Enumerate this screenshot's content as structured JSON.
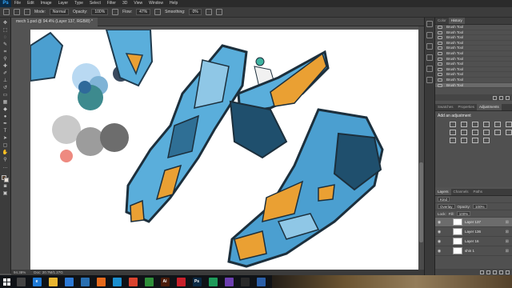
{
  "menu": {
    "logo": "Ps",
    "items": [
      "File",
      "Edit",
      "Image",
      "Layer",
      "Type",
      "Select",
      "Filter",
      "3D",
      "View",
      "Window",
      "Help"
    ]
  },
  "options": {
    "mode_label": "Mode:",
    "mode_value": "Normal",
    "opacity_label": "Opacity:",
    "opacity_value": "100%",
    "flow_label": "Flow:",
    "flow_value": "47%",
    "smoothing_label": "Smoothing:",
    "smoothing_value": "0%"
  },
  "document": {
    "tab_title": "mech 1.psd @ 94.4% (Layer 137, RGB/8) *",
    "zoom": "94.38%",
    "doc_info": "Doc: 20.7M/1.27G"
  },
  "history": {
    "tabs": [
      "Color",
      "History"
    ],
    "active_tab": "History",
    "rows": [
      "Brush Tool",
      "Brush Tool",
      "Brush Tool",
      "Brush Tool",
      "Brush Tool",
      "Brush Tool",
      "Brush Tool",
      "Brush Tool",
      "Brush Tool",
      "Brush Tool",
      "Brush Tool",
      "Brush Tool"
    ],
    "selected_index": 11
  },
  "adjustments": {
    "tabs": [
      "Swatches",
      "Properties",
      "Adjustments"
    ],
    "active_tab": "Adjustments",
    "label": "Add an adjustment"
  },
  "layers": {
    "tabs": [
      "Layers",
      "Channels",
      "Paths"
    ],
    "active_tab": "Layers",
    "kind_label": "Kind",
    "blend_mode": "Overlay",
    "opacity_label": "Opacity:",
    "opacity_value": "100%",
    "lock_label": "Lock:",
    "fill_label": "Fill:",
    "fill_value": "100%",
    "rows": [
      {
        "name": "Layer 137",
        "selected": true
      },
      {
        "name": "Layer 136",
        "selected": false
      },
      {
        "name": "Layer 16",
        "selected": false
      },
      {
        "name": "shin 1",
        "selected": false
      }
    ]
  },
  "taskbar": {
    "apps": [
      {
        "name": "task-view",
        "color": "#444444",
        "text": ""
      },
      {
        "name": "edge",
        "color": "#1f7ad6",
        "text": "e"
      },
      {
        "name": "file-explorer",
        "color": "#e8b531",
        "text": ""
      },
      {
        "name": "store",
        "color": "#2d7ad6",
        "text": ""
      },
      {
        "name": "app-box",
        "color": "#2a6fb0",
        "text": ""
      },
      {
        "name": "firefox",
        "color": "#e66a1c",
        "text": ""
      },
      {
        "name": "app-swirl",
        "color": "#1c8fcf",
        "text": ""
      },
      {
        "name": "chrome",
        "color": "#d9442f",
        "text": ""
      },
      {
        "name": "media-player",
        "color": "#2f8f3a",
        "text": ""
      },
      {
        "name": "illustrator",
        "color": "#4b1c0a",
        "text": "Ai"
      },
      {
        "name": "app-red",
        "color": "#c8202a",
        "text": ""
      },
      {
        "name": "photoshop",
        "color": "#0b2a45",
        "text": "Ps"
      },
      {
        "name": "app-note",
        "color": "#1e9a5a",
        "text": ""
      },
      {
        "name": "visual-studio",
        "color": "#6c3fb0",
        "text": ""
      },
      {
        "name": "obs",
        "color": "#2a2a2a",
        "text": ""
      },
      {
        "name": "app-blue",
        "color": "#2b5fa8",
        "text": ""
      }
    ]
  },
  "colors": {
    "accent": "#31a8ff",
    "mech_light": "#5aaedb",
    "mech_dark": "#1f4f6d",
    "mech_orange": "#eaa033"
  }
}
